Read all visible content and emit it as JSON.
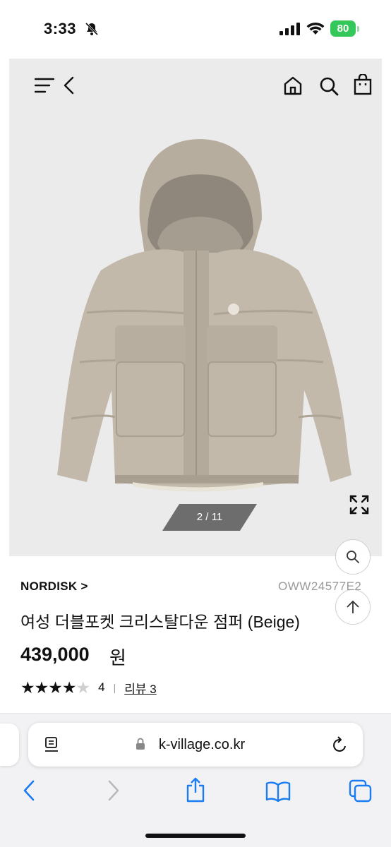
{
  "status_bar": {
    "time": "3:33",
    "battery": "80"
  },
  "gallery": {
    "counter": "2 / 11"
  },
  "product": {
    "brand": "NORDISK >",
    "sku": "OWW24577E2",
    "title": "여성 더블포켓 크리스탈다운 점퍼 (Beige)",
    "price": "439,000",
    "price_unit": "원",
    "rating_stars": 4,
    "rating_count": "4",
    "rating_sep": "|",
    "review_link": "리뷰 3"
  },
  "browser": {
    "url": "k-village.co.kr"
  },
  "colors": {
    "battery": "#34c759",
    "accent_blue": "#1a7cf2",
    "image_bg": "#ebebeb"
  },
  "icons": [
    "bell-slash-icon",
    "signal-icon",
    "wifi-icon",
    "menu-icon",
    "back-icon",
    "home-icon",
    "search-icon",
    "bag-icon",
    "expand-icon",
    "zoom-icon",
    "scroll-top-icon",
    "reader-icon",
    "lock-icon",
    "reload-icon",
    "share-icon",
    "bookmarks-icon",
    "tabs-icon"
  ]
}
